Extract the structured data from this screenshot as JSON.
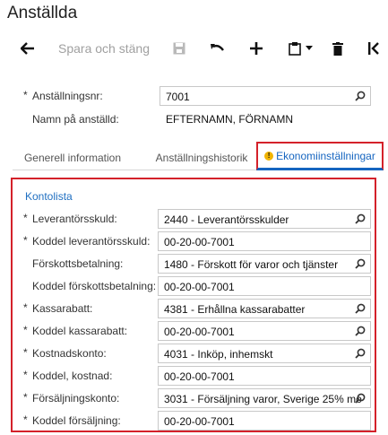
{
  "page": {
    "title": "Anställda"
  },
  "toolbar": {
    "back_icon": "arrow-left-icon",
    "save_close_label": "Spara och stäng",
    "save_icon": "floppy-disk-icon",
    "undo_icon": "undo-arrow-icon",
    "add_icon": "plus-icon",
    "clipboard_icon": "clipboard-icon",
    "delete_icon": "trash-icon",
    "first_icon": "first-record-icon"
  },
  "header": {
    "employee_no_label": "Anställningsnr:",
    "employee_no_value": "7001",
    "employee_name_label": "Namn på anställd:",
    "employee_name_value": "EFTERNAMN, FÖRNAMN"
  },
  "tabs": [
    {
      "label": "Generell information"
    },
    {
      "label": "Anställningshistorik"
    },
    {
      "label": "Ekonomiinställningar"
    }
  ],
  "accounts": {
    "section_title": "Kontolista",
    "rows": [
      {
        "label": "Leverantörsskuld:",
        "value": "2440 - Leverantörsskulder",
        "required": "*",
        "lookup": true
      },
      {
        "label": "Koddel leverantörsskuld:",
        "value": "00-20-00-7001",
        "required": "*",
        "lookup": false
      },
      {
        "label": "Förskottsbetalning:",
        "value": "1480 - Förskott för varor och tjänster",
        "required": "",
        "lookup": true
      },
      {
        "label": "Koddel förskottsbetalning:",
        "value": "00-20-00-7001",
        "required": "",
        "lookup": false
      },
      {
        "label": "Kassarabatt:",
        "value": "4381 - Erhållna kassarabatter",
        "required": "*",
        "lookup": true
      },
      {
        "label": "Koddel kassarabatt:",
        "value": "00-20-00-7001",
        "required": "*",
        "lookup": true
      },
      {
        "label": "Kostnadskonto:",
        "value": "4031 - Inköp, inhemskt",
        "required": "*",
        "lookup": true
      },
      {
        "label": "Koddel, kostnad:",
        "value": "00-20-00-7001",
        "required": "*",
        "lookup": false
      },
      {
        "label": "Försäljningskonto:",
        "value": "3031 - Försäljning varor, Sverige 25% mo",
        "required": "*",
        "lookup": true
      },
      {
        "label": "Koddel försäljning:",
        "value": "00-20-00-7001",
        "required": "*",
        "lookup": false
      }
    ]
  },
  "colors": {
    "accent_blue": "#1565c0",
    "highlight_red": "#d4212a",
    "warning_yellow": "#f1b400"
  }
}
